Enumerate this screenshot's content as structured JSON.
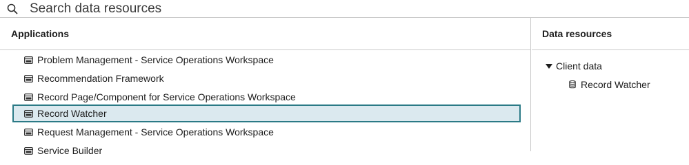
{
  "search": {
    "placeholder": "Search data resources",
    "icon": "search-icon"
  },
  "applications": {
    "header": "Applications",
    "items": [
      {
        "label": "Problem Management - Service Operations Workspace",
        "selected": false,
        "icon": "app-window-icon"
      },
      {
        "label": "Recommendation Framework",
        "selected": false,
        "icon": "app-window-icon"
      },
      {
        "label": "Record Page/Component for Service Operations Workspace",
        "selected": false,
        "icon": "app-window-icon"
      },
      {
        "label": "Record Watcher",
        "selected": true,
        "icon": "app-window-icon"
      },
      {
        "label": "Request Management - Service Operations Workspace",
        "selected": false,
        "icon": "app-window-icon"
      },
      {
        "label": "Service Builder",
        "selected": false,
        "icon": "app-window-icon"
      }
    ]
  },
  "data_resources": {
    "header": "Data resources",
    "tree": {
      "label": "Client data",
      "expanded": true,
      "children": [
        {
          "label": "Record Watcher",
          "icon": "database-icon"
        }
      ]
    }
  },
  "colors": {
    "selected_bg": "#dbe9ef",
    "selected_border": "#2b7a86",
    "divider": "#c9c9c9"
  }
}
